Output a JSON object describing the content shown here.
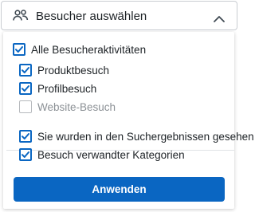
{
  "header": {
    "label": "Besucher auswählen",
    "icon": "people-icon",
    "chevron": "chevron-up-icon"
  },
  "options": [
    {
      "label": "Alle Besucheraktivitäten",
      "checked": true,
      "disabled": false
    },
    {
      "label": "Produktbesuch",
      "checked": true,
      "disabled": false
    },
    {
      "label": "Profilbesuch",
      "checked": true,
      "disabled": false
    },
    {
      "label": "Website-Besuch",
      "checked": false,
      "disabled": true
    },
    {
      "label": "Sie wurden in den Suchergebnissen gesehen",
      "checked": true,
      "disabled": false
    },
    {
      "label": "Besuch verwandter Kategorien",
      "checked": true,
      "disabled": false
    }
  ],
  "apply_label": "Anwenden",
  "colors": {
    "accent": "#0a66c2",
    "disabled": "#b6b9bd"
  }
}
